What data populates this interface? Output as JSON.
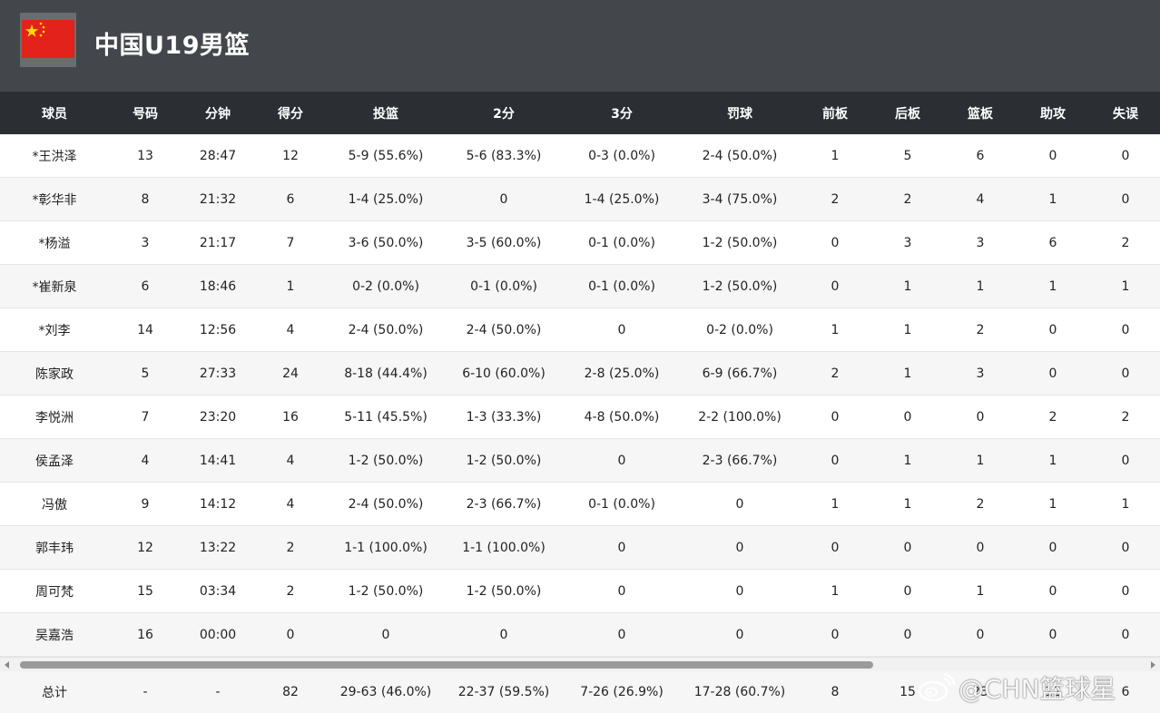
{
  "team": {
    "name": "中国U19男篮",
    "flag_colors": {
      "red": "#e3231b",
      "star": "#ffde00"
    }
  },
  "columns": [
    "球员",
    "号码",
    "分钟",
    "得分",
    "投篮",
    "2分",
    "3分",
    "罚球",
    "前板",
    "后板",
    "篮板",
    "助攻",
    "失误"
  ],
  "rows": [
    [
      "*王洪泽",
      "13",
      "28:47",
      "12",
      "5-9 (55.6%)",
      "5-6 (83.3%)",
      "0-3 (0.0%)",
      "2-4 (50.0%)",
      "1",
      "5",
      "6",
      "0",
      "0"
    ],
    [
      "*彰华非",
      "8",
      "21:32",
      "6",
      "1-4 (25.0%)",
      "0",
      "1-4 (25.0%)",
      "3-4 (75.0%)",
      "2",
      "2",
      "4",
      "1",
      "0"
    ],
    [
      "*杨溢",
      "3",
      "21:17",
      "7",
      "3-6 (50.0%)",
      "3-5 (60.0%)",
      "0-1 (0.0%)",
      "1-2 (50.0%)",
      "0",
      "3",
      "3",
      "6",
      "2"
    ],
    [
      "*崔新泉",
      "6",
      "18:46",
      "1",
      "0-2 (0.0%)",
      "0-1 (0.0%)",
      "0-1 (0.0%)",
      "1-2 (50.0%)",
      "0",
      "1",
      "1",
      "1",
      "1"
    ],
    [
      "*刘李",
      "14",
      "12:56",
      "4",
      "2-4 (50.0%)",
      "2-4 (50.0%)",
      "0",
      "0-2 (0.0%)",
      "1",
      "1",
      "2",
      "0",
      "0"
    ],
    [
      "陈家政",
      "5",
      "27:33",
      "24",
      "8-18 (44.4%)",
      "6-10 (60.0%)",
      "2-8 (25.0%)",
      "6-9 (66.7%)",
      "2",
      "1",
      "3",
      "0",
      "0"
    ],
    [
      "李悦洲",
      "7",
      "23:20",
      "16",
      "5-11 (45.5%)",
      "1-3 (33.3%)",
      "4-8 (50.0%)",
      "2-2 (100.0%)",
      "0",
      "0",
      "0",
      "2",
      "2"
    ],
    [
      "侯孟泽",
      "4",
      "14:41",
      "4",
      "1-2 (50.0%)",
      "1-2 (50.0%)",
      "0",
      "2-3 (66.7%)",
      "0",
      "1",
      "1",
      "1",
      "0"
    ],
    [
      "冯傲",
      "9",
      "14:12",
      "4",
      "2-4 (50.0%)",
      "2-3 (66.7%)",
      "0-1 (0.0%)",
      "0",
      "1",
      "1",
      "2",
      "1",
      "1"
    ],
    [
      "郭丰玮",
      "12",
      "13:22",
      "2",
      "1-1 (100.0%)",
      "1-1 (100.0%)",
      "0",
      "0",
      "0",
      "0",
      "0",
      "0",
      "0"
    ],
    [
      "周可梵",
      "15",
      "03:34",
      "2",
      "1-2 (50.0%)",
      "1-2 (50.0%)",
      "0",
      "0",
      "1",
      "0",
      "1",
      "0",
      "0"
    ],
    [
      "吴嘉浩",
      "16",
      "00:00",
      "0",
      "0",
      "0",
      "0",
      "0",
      "0",
      "0",
      "0",
      "0",
      "0"
    ]
  ],
  "total": [
    "总计",
    "-",
    "-",
    "82",
    "29-63 (46.0%)",
    "22-37 (59.5%)",
    "7-26 (26.9%)",
    "17-28 (60.7%)",
    "8",
    "15",
    "23",
    "12",
    "6"
  ],
  "watermark": {
    "text": "@CHN篮球星"
  }
}
